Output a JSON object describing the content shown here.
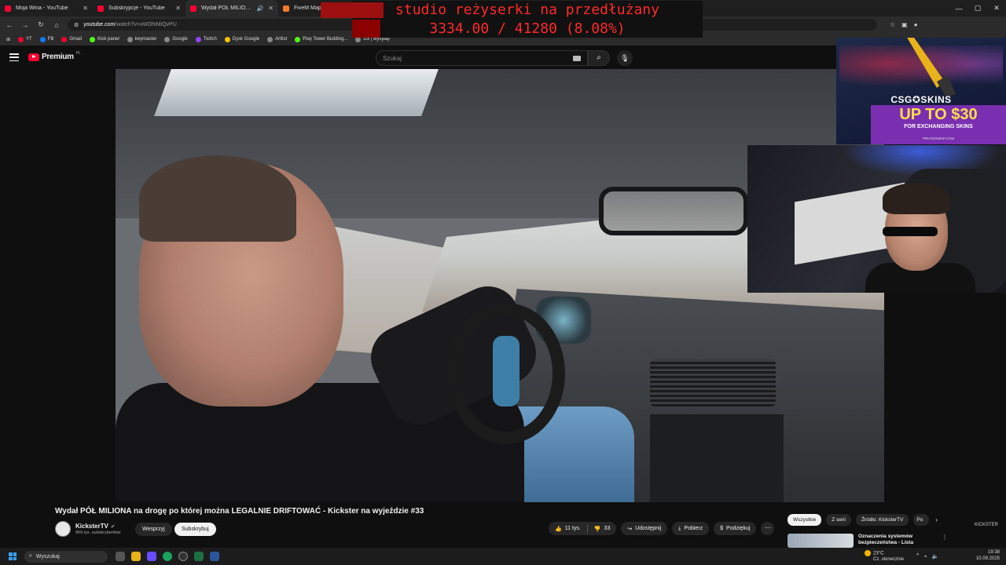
{
  "browser": {
    "tabs": [
      {
        "label": "Moja Wina - YouTube",
        "icon": "youtube-icon",
        "active": false
      },
      {
        "label": "Subskrypcje - YouTube",
        "icon": "youtube-icon",
        "active": false
      },
      {
        "label": "Wydał PÓŁ MILIONA na dr",
        "icon": "youtube-icon",
        "active": true
      },
      {
        "label": "FiveM Map / GTAV Interior Coll",
        "icon": "map-icon",
        "active": false
      }
    ],
    "url_host": "youtube.com",
    "url_path": "/watch?v=xWDhiMiQvPU",
    "bookmarks": [
      "YT",
      "FB",
      "Gmail",
      "Kick panel",
      "keymaster",
      "Google",
      "Twitch",
      "Dysk Google",
      "Artlist",
      "Play Tower Building...",
      "ctx | wysyłay"
    ]
  },
  "youtube": {
    "logo_text": "Premium",
    "logo_region": "PL",
    "search_placeholder": "Szukaj"
  },
  "overlay": {
    "goal_name": "studio reżyserki na przedłużany",
    "goal_progress": "3334.00 / 41280 (8.08%)",
    "goal_fraction": 0.0808,
    "ad_brand": "CSG✪SKINS",
    "ad_headline": "UP TO $30",
    "ad_sub": "FOR EXCHANGING SKINS",
    "ad_site": "PIRATESWAP.COM"
  },
  "video": {
    "title": "Wydał PÓŁ MILIONA na drogę po której można LEGALNIE DRIFTOWAĆ - Kickster na wyjeździe #33",
    "channel": "KicksterTV",
    "subscribers": "969 tys. subskrybentów",
    "join_label": "Wesprzyj",
    "subscribe_label": "Subskrybuj",
    "likes": "11 tys.",
    "comments": "33",
    "share_label": "Udostępnij",
    "download_label": "Pobierz",
    "thanks_label": "Podziękuj",
    "watermark": "KICKSTER"
  },
  "sidebar": {
    "chips": [
      "Wszystkie",
      "Z serii",
      "Źródło: KicksterTV",
      "Po"
    ],
    "rec_title": "Oznaczenia systemów bezpieczeństwa - Lista"
  },
  "taskbar": {
    "search_placeholder": "Wyszukaj",
    "temperature": "23°C",
    "weather": "Cz. słonecznie",
    "time": "19:38",
    "date": "10.09.2025"
  }
}
